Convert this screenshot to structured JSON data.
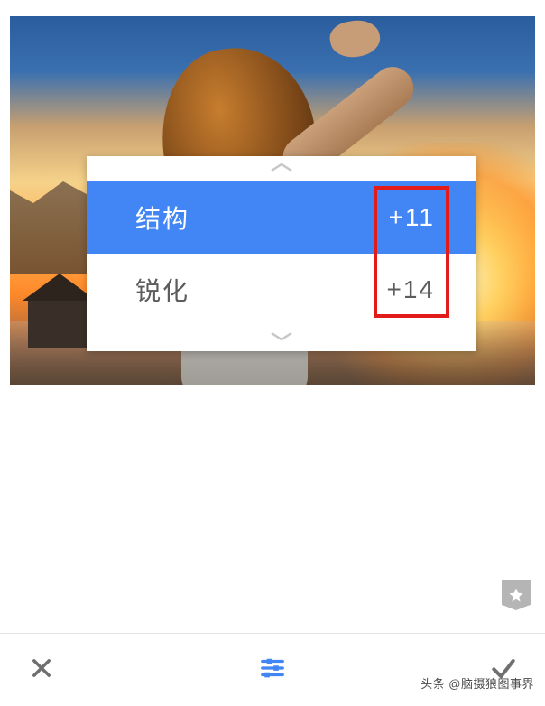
{
  "panel": {
    "items": [
      {
        "label": "结构",
        "value": "+11",
        "selected": true
      },
      {
        "label": "锐化",
        "value": "+14",
        "selected": false
      }
    ]
  },
  "icons": {
    "chevron_up": "chevron-up",
    "chevron_down": "chevron-down",
    "favorite": "star",
    "cancel": "close",
    "adjust": "sliders",
    "confirm": "check"
  },
  "colors": {
    "accent": "#4285f4",
    "highlight": "#e21b1b"
  },
  "watermark": "头条 @脑摄狼图事界"
}
